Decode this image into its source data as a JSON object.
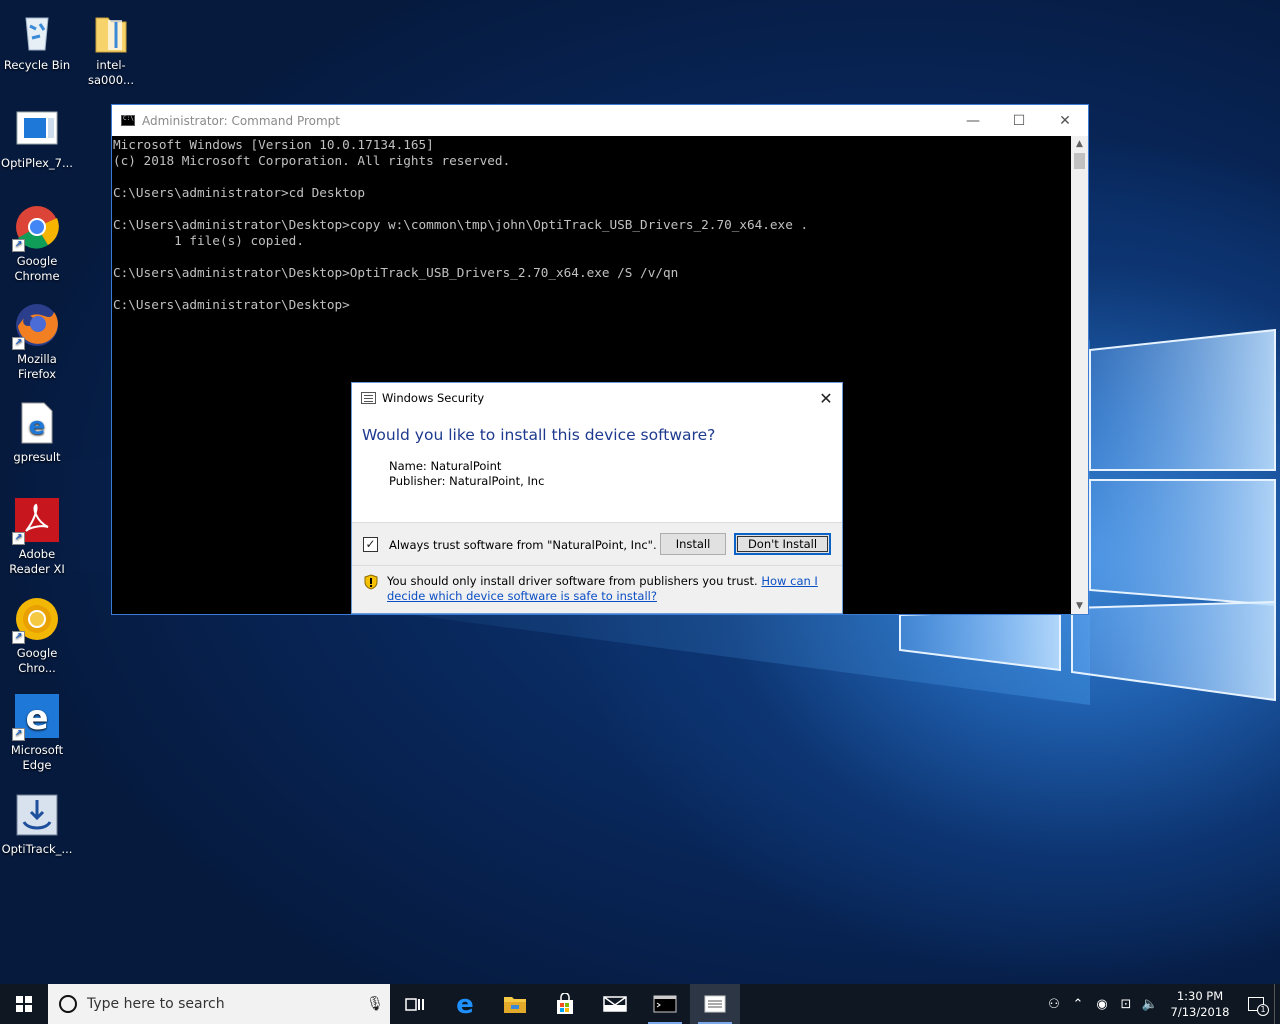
{
  "desktop": {
    "icons": [
      {
        "label": "Recycle Bin"
      },
      {
        "label": "intel-sa000..."
      },
      {
        "label": "OptiPlex_7..."
      },
      {
        "label": "Google Chrome"
      },
      {
        "label": "Mozilla Firefox"
      },
      {
        "label": "gpresult"
      },
      {
        "label": "Adobe Reader XI"
      },
      {
        "label": "Google Chro..."
      },
      {
        "label": "Microsoft Edge"
      },
      {
        "label": "OptiTrack_..."
      }
    ]
  },
  "cmd": {
    "title": "Administrator: Command Prompt",
    "minimize": "—",
    "maximize": "☐",
    "close": "✕",
    "output": "Microsoft Windows [Version 10.0.17134.165]\n(c) 2018 Microsoft Corporation. All rights reserved.\n\nC:\\Users\\administrator>cd Desktop\n\nC:\\Users\\administrator\\Desktop>copy w:\\common\\tmp\\john\\OptiTrack_USB_Drivers_2.70_x64.exe .\n        1 file(s) copied.\n\nC:\\Users\\administrator\\Desktop>OptiTrack_USB_Drivers_2.70_x64.exe /S /v/qn\n\nC:\\Users\\administrator\\Desktop>"
  },
  "security_dialog": {
    "title": "Windows Security",
    "close": "✕",
    "question": "Would you like to install this device software?",
    "name_line": "Name: NaturalPoint",
    "publisher_line": "Publisher: NaturalPoint, Inc",
    "trust_checkbox_checked": true,
    "trust_checkbox_mark": "✓",
    "trust_label": "Always trust software from \"NaturalPoint, Inc\".",
    "install_button": "Install",
    "dont_install_button": "Don't Install",
    "warning_text": "You should only install driver software from publishers you trust.",
    "warning_link": "How can I decide which device software is safe to install?"
  },
  "taskbar": {
    "search_placeholder": "Type here to search",
    "time": "1:30 PM",
    "date": "7/13/2018",
    "notification_count": "1"
  },
  "colors": {
    "accent": "#0a64c8",
    "dialog_heading": "#1e3a8f",
    "taskbar": "#0f1722",
    "cmd_text": "#c0c0c0"
  }
}
